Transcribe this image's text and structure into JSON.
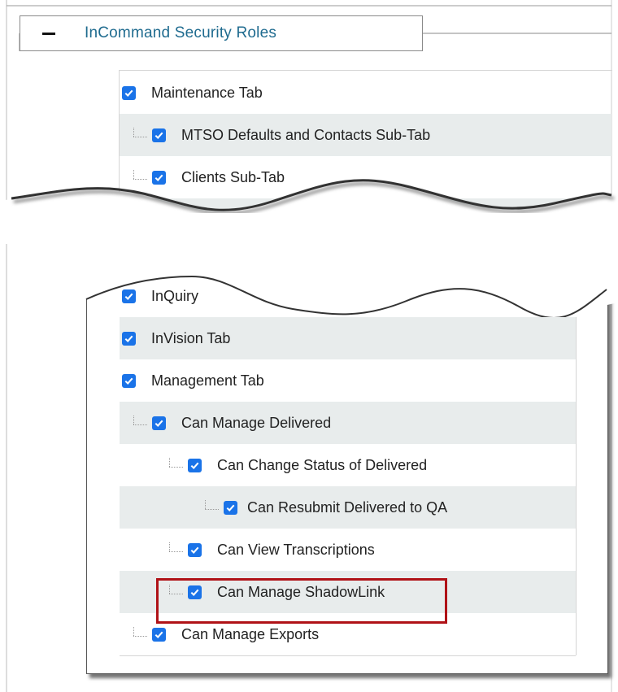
{
  "section": {
    "title": "InCommand Security Roles",
    "collapse_icon": "minus-icon"
  },
  "top_panel": {
    "rows": [
      {
        "label": "Maintenance Tab",
        "checked": true,
        "level": 0
      },
      {
        "label": "MTSO Defaults and Contacts Sub-Tab",
        "checked": true,
        "level": 1
      },
      {
        "label": "Clients Sub-Tab",
        "checked": true,
        "level": 1
      }
    ]
  },
  "bottom_panel": {
    "rows": [
      {
        "label": "InQuiry",
        "checked": true,
        "level": 0
      },
      {
        "label": "InVision Tab",
        "checked": true,
        "level": 0
      },
      {
        "label": "Management Tab",
        "checked": true,
        "level": 0
      },
      {
        "label": "Can Manage Delivered",
        "checked": true,
        "level": 1
      },
      {
        "label": "Can Change Status of Delivered",
        "checked": true,
        "level": 2
      },
      {
        "label": "Can Resubmit Delivered to QA",
        "checked": true,
        "level": 3
      },
      {
        "label": "Can View Transcriptions",
        "checked": true,
        "level": 2
      },
      {
        "label": "Can Manage ShadowLink",
        "checked": true,
        "level": 2,
        "highlighted": true
      },
      {
        "label": "Can Manage Exports",
        "checked": true,
        "level": 1
      }
    ]
  },
  "colors": {
    "accent": "#1a73e8",
    "title": "#1f6b8f",
    "highlight": "#b01217",
    "row_shade": "#e8ecec"
  }
}
